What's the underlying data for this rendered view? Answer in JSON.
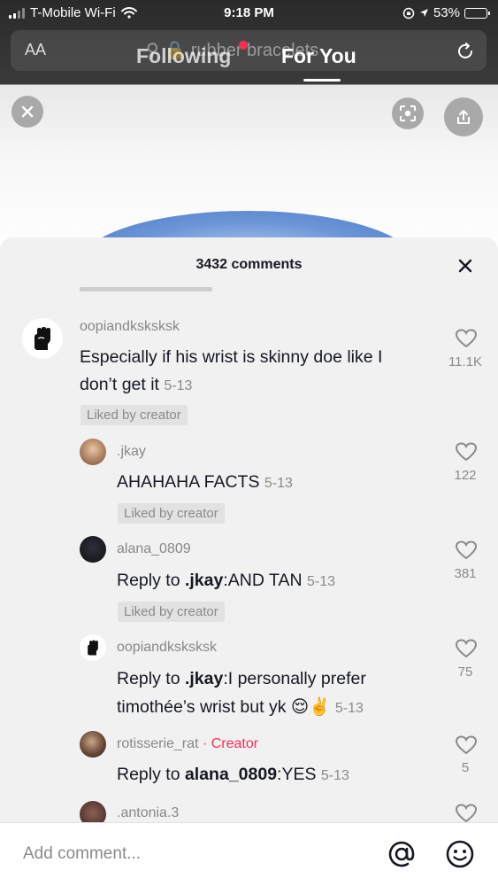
{
  "status_bar": {
    "carrier": "T-Mobile Wi-Fi",
    "time": "9:18 PM",
    "battery": "53%",
    "battery_level": 0.53
  },
  "top_nav": {
    "text_size_label": "AA",
    "search_hint": "rubber bracelets",
    "tab_following": "Following",
    "tab_for_you": "For You",
    "active_tab": "For You"
  },
  "sheet": {
    "title": "3432 comments",
    "comments": [
      {
        "username": "oopiandksksksk",
        "avatar": "raised-fist",
        "line1": "Especially if his wrist is skinny doe like I",
        "line2": "don’t get it",
        "date": "5-13",
        "badge": "Liked by creator",
        "likes": "11.1K"
      }
    ],
    "replies": [
      {
        "username": ".jkay",
        "text": "AHAHAHA FACTS",
        "date": "5-13",
        "badge": "Liked by creator",
        "likes": "122"
      },
      {
        "username": "alana_0809",
        "reply_prefix": "Reply to ",
        "reply_to": ".jkay",
        "text": ":AND TAN",
        "date": "5-13",
        "badge": "Liked by creator",
        "likes": "381"
      },
      {
        "username": "oopiandksksksk",
        "reply_prefix": "Reply to ",
        "reply_to": ".jkay",
        "text": ":I personally prefer",
        "line2": "timothée’s wrist but yk 😌✌️",
        "date": "5-13",
        "likes": "75"
      },
      {
        "username": "rotisserie_rat",
        "separator": "·",
        "creator_label": "Creator",
        "reply_prefix": "Reply to ",
        "reply_to": "alana_0809",
        "text": ":YES",
        "date": "5-13",
        "likes": "5"
      },
      {
        "username": ".antonia.3"
      }
    ]
  },
  "bottom_bar": {
    "placeholder": "Add comment..."
  },
  "colors": {
    "accent": "#fe2c55",
    "sheet_bg": "#f1f1f2",
    "text": "#161823",
    "muted": "#8a8a8a"
  }
}
